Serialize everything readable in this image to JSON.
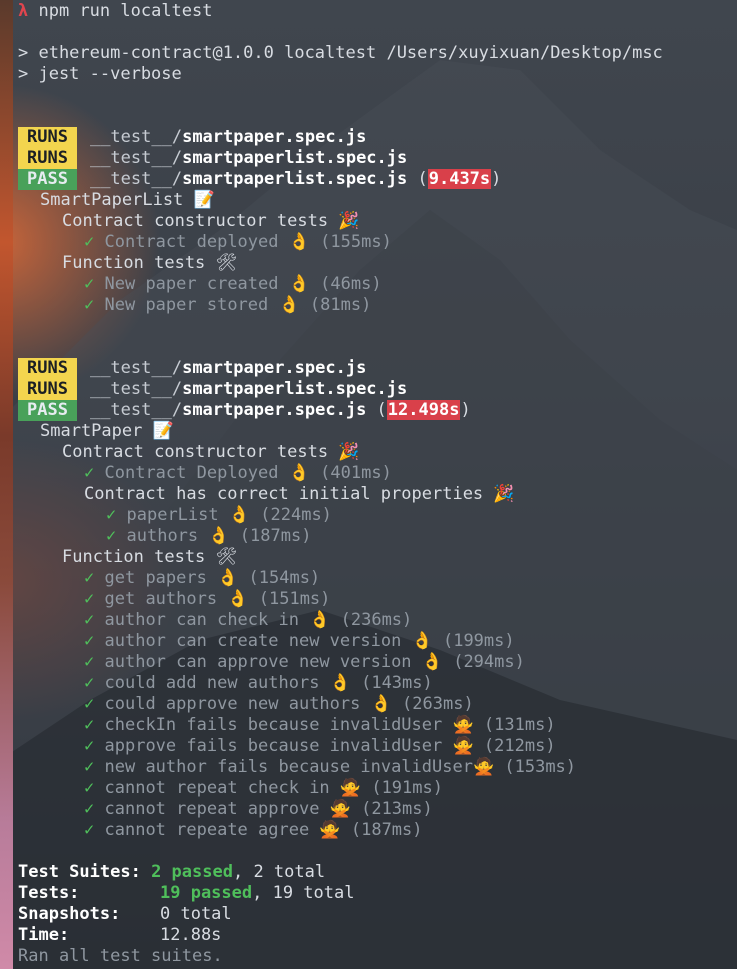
{
  "prompt": {
    "symbol": "λ",
    "command": "npm run localtest"
  },
  "npm_output": {
    "line1": "> ethereum-contract@1.0.0 localtest /Users/xuyixuan/Desktop/msc",
    "line2": "> jest --verbose"
  },
  "badges": {
    "runs": "RUNS",
    "pass": "PASS"
  },
  "paths": {
    "dir": "__test__/",
    "smartpaper": "smartpaper.spec.js",
    "smartpaperlist": "smartpaperlist.spec.js"
  },
  "run1": {
    "time": "9.437s"
  },
  "run2": {
    "time": "12.498s"
  },
  "suite1": {
    "name": "SmartPaperList 📝",
    "group1": "Contract constructor tests 🎉",
    "t1": {
      "label": "Contract deployed 👌",
      "time": "(155ms)"
    },
    "group2": "Function tests 🛠",
    "t2": {
      "label": "New paper created 👌",
      "time": "(46ms)"
    },
    "t3": {
      "label": "New paper stored 👌",
      "time": "(81ms)"
    }
  },
  "suite2": {
    "name": "SmartPaper 📝",
    "group1": "Contract constructor tests 🎉",
    "t1": {
      "label": "Contract Deployed 👌",
      "time": "(401ms)"
    },
    "subgroup": "Contract has correct initial properties 🎉",
    "t2": {
      "label": "paperList 👌",
      "time": "(224ms)"
    },
    "t3": {
      "label": "authors 👌",
      "time": "(187ms)"
    },
    "group2": "Function tests 🛠",
    "tests": [
      {
        "label": "get papers 👌",
        "time": "(154ms)"
      },
      {
        "label": "get authors 👌",
        "time": "(151ms)"
      },
      {
        "label": "author can check in 👌",
        "time": "(236ms)"
      },
      {
        "label": "author can create new version 👌",
        "time": "(199ms)"
      },
      {
        "label": "author can approve new version 👌",
        "time": "(294ms)"
      },
      {
        "label": "could add new authors 👌",
        "time": "(143ms)"
      },
      {
        "label": "could approve new authors 👌",
        "time": "(263ms)"
      },
      {
        "label": "checkIn fails because invalidUser 🙅",
        "time": "(131ms)"
      },
      {
        "label": "approve fails because invalidUser 🙅",
        "time": "(212ms)"
      },
      {
        "label": "new author fails because invalidUser🙅",
        "time": "(153ms)"
      },
      {
        "label": "cannot repeat check in 🙅",
        "time": "(191ms)"
      },
      {
        "label": "cannot repeat approve 🙅",
        "time": "(213ms)"
      },
      {
        "label": "cannot repeate agree 🙅",
        "time": "(187ms)"
      }
    ]
  },
  "check_mark": "✓",
  "summary": {
    "suites_label": "Test Suites:",
    "suites_passed": "2 passed",
    "suites_total": ", 2 total",
    "tests_label": "Tests:",
    "tests_passed": "19 passed",
    "tests_total": ", 19 total",
    "snapshots_label": "Snapshots:",
    "snapshots_value": "0 total",
    "time_label": "Time:",
    "time_value": "12.88s",
    "footer": "Ran all test suites."
  }
}
